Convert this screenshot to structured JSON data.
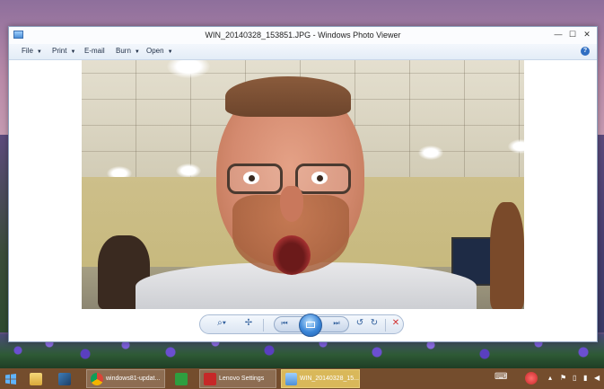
{
  "window": {
    "title": "WIN_20140328_153851.JPG - Windows Photo Viewer",
    "controls": {
      "minimize": "—",
      "maximize": "☐",
      "close": "✕"
    }
  },
  "menubar": {
    "items": [
      {
        "label": "File",
        "has_dropdown": true
      },
      {
        "label": "Print",
        "has_dropdown": true
      },
      {
        "label": "E-mail",
        "has_dropdown": false
      },
      {
        "label": "Burn",
        "has_dropdown": true
      },
      {
        "label": "Open",
        "has_dropdown": true
      }
    ],
    "caret": "▼",
    "help": "?"
  },
  "photo_controls": {
    "zoom": "⌕▾",
    "actual_size": "✢",
    "previous": "⏮",
    "next": "⏭",
    "rotate_ccw": "↺",
    "rotate_cw": "↻",
    "delete": "✕"
  },
  "taskbar": {
    "start_icon": "windows-logo-icon",
    "items": [
      {
        "label": "",
        "icon": "file-explorer-icon"
      },
      {
        "label": "",
        "icon": "app-icon"
      },
      {
        "label": "windows81-updat...",
        "icon": "chrome-icon"
      },
      {
        "label": "",
        "icon": "office-icon"
      },
      {
        "label": "Lenovo Settings",
        "icon": "lenovo-settings-icon"
      },
      {
        "label": "WIN_20140328_15...",
        "icon": "photo-viewer-icon"
      }
    ],
    "tray": [
      "⌨",
      "▴",
      "⚑",
      "▯",
      "▮",
      "◀"
    ]
  },
  "colors": {
    "accent": "#2f6ec2",
    "delete": "#d02f2f",
    "taskbar": "#784e28"
  }
}
